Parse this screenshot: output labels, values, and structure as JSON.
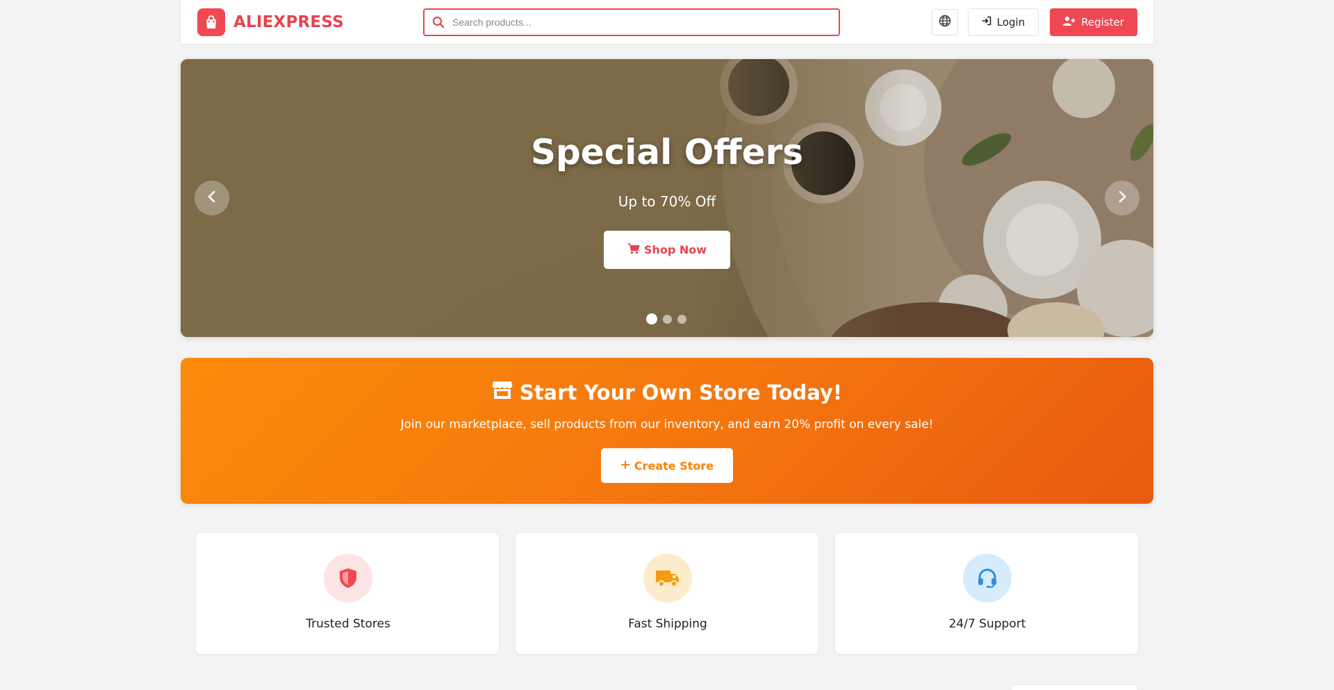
{
  "header": {
    "brand": "ALIEXPRESS",
    "search_placeholder": "Search products...",
    "login_label": "Login",
    "register_label": "Register"
  },
  "hero": {
    "title": "Special Offers",
    "subtitle": "Up to 70% Off",
    "cta_label": "Shop Now",
    "slide_count": 3,
    "active_slide": 1
  },
  "promo": {
    "title": "Start Your Own Store Today!",
    "subtitle": "Join our marketplace, sell products from our inventory, and earn 20% profit on every sale!",
    "cta_label": "Create Store"
  },
  "features": [
    {
      "label": "Trusted Stores",
      "icon": "shield-icon",
      "icon_color": "#ef4853",
      "bg_color": "#fde4e5"
    },
    {
      "label": "Fast Shipping",
      "icon": "truck-icon",
      "icon_color": "#f39c12",
      "bg_color": "#fdeccc"
    },
    {
      "label": "24/7 Support",
      "icon": "headset-icon",
      "icon_color": "#2f8fe0",
      "bg_color": "#d6ebfb"
    }
  ],
  "colors": {
    "brand": "#ef4853",
    "promo_orange": "#f5780e",
    "page_bg": "#f3f3f4"
  }
}
